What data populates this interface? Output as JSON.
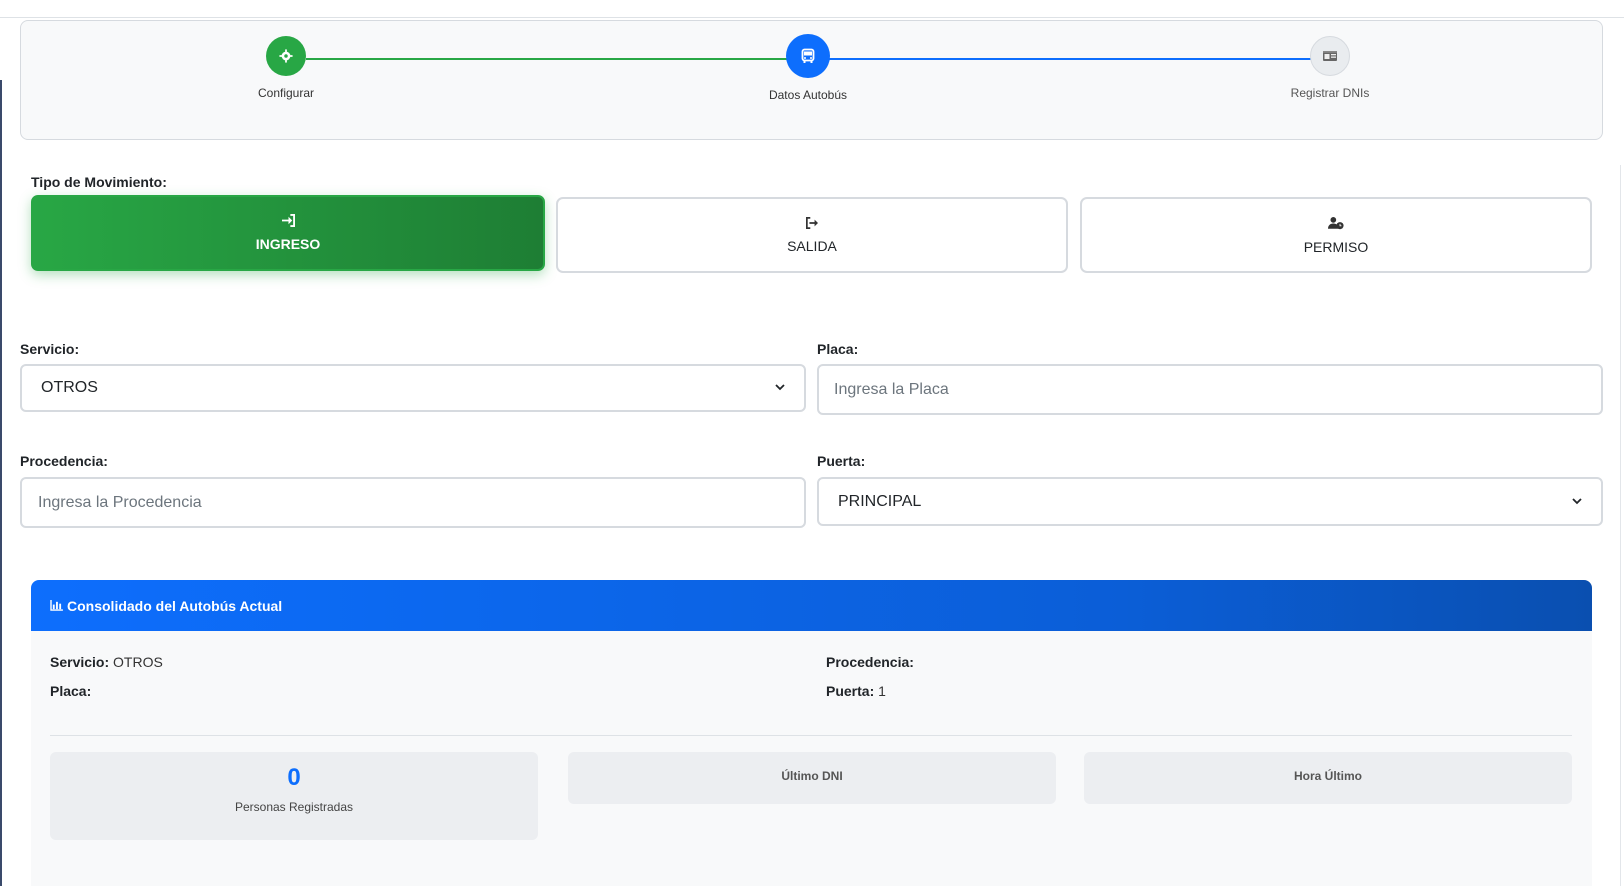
{
  "stepper": {
    "steps": [
      {
        "label": "Configurar",
        "icon": "gear-icon",
        "state": "complete"
      },
      {
        "label": "Datos Autobús",
        "icon": "bus-icon",
        "state": "active"
      },
      {
        "label": "Registrar DNIs",
        "icon": "id-card-icon",
        "state": "pending"
      }
    ]
  },
  "movimiento": {
    "label": "Tipo de Movimiento:",
    "options": [
      {
        "label": "INGRESO",
        "icon": "sign-in-icon",
        "selected": true
      },
      {
        "label": "SALIDA",
        "icon": "sign-out-icon",
        "selected": false
      },
      {
        "label": "PERMISO",
        "icon": "user-clock-icon",
        "selected": false
      }
    ]
  },
  "form": {
    "servicio": {
      "label": "Servicio:",
      "value": "OTROS"
    },
    "placa": {
      "label": "Placa:",
      "placeholder": "Ingresa la Placa"
    },
    "procedencia": {
      "label": "Procedencia:",
      "placeholder": "Ingresa la Procedencia"
    },
    "puerta": {
      "label": "Puerta:",
      "value": "PRINCIPAL"
    }
  },
  "consolidado": {
    "title": "Consolidado del Autobús Actual",
    "servicio_label": "Servicio:",
    "servicio_value": "OTROS",
    "placa_label": "Placa:",
    "placa_value": "",
    "procedencia_label": "Procedencia:",
    "procedencia_value": "",
    "puerta_label": "Puerta:",
    "puerta_value": "1",
    "stats": {
      "personas_value": "0",
      "personas_label": "Personas Registradas",
      "ultimo_dni_label": "Último DNI",
      "hora_ultimo_label": "Hora Último"
    }
  },
  "colors": {
    "success": "#28a745",
    "primary": "#0d6efd",
    "border": "#d6dadf"
  }
}
